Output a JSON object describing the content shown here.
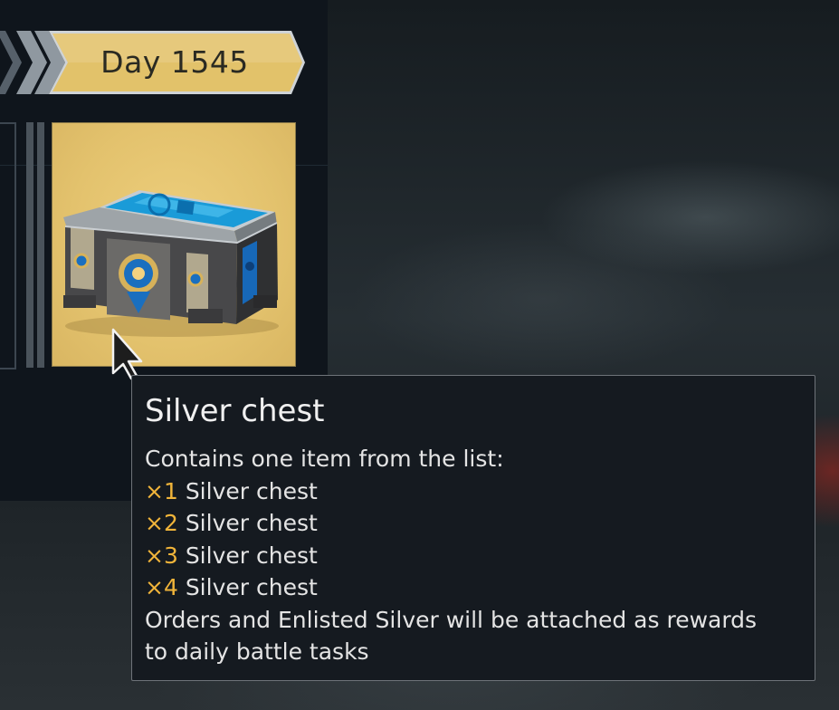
{
  "header": {
    "day_label": "Day 1545"
  },
  "reward": {
    "name": "Silver chest"
  },
  "tooltip": {
    "title": "Silver chest",
    "intro": "Contains one item from the list:",
    "items": [
      {
        "qty": "×1",
        "label": "Silver chest"
      },
      {
        "qty": "×2",
        "label": "Silver chest"
      },
      {
        "qty": "×3",
        "label": "Silver chest"
      },
      {
        "qty": "×4",
        "label": "Silver chest"
      }
    ],
    "note_line1": "Orders and Enlisted Silver will be attached as rewards",
    "note_line2": "to daily battle tasks"
  },
  "colors": {
    "banner_gold": "#e2c26a",
    "card_background": "#e3c26d",
    "quantity_accent": "#f0b43a",
    "panel_background": "#0f151c"
  }
}
